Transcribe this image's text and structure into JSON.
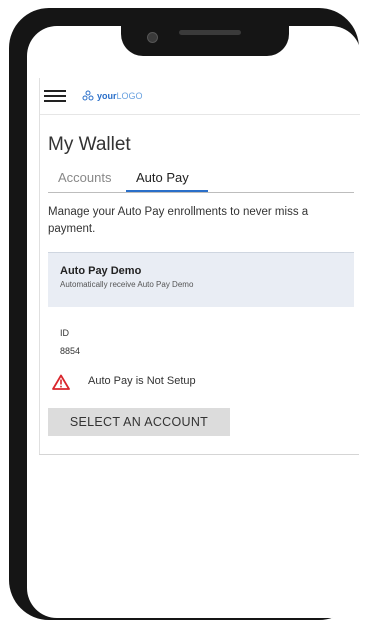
{
  "header": {
    "logo_prefix": "your",
    "logo_suffix": "LOGO"
  },
  "page": {
    "title": "My Wallet",
    "tabs": [
      {
        "label": "Accounts",
        "active": false
      },
      {
        "label": "Auto Pay",
        "active": true
      }
    ],
    "description": "Manage your Auto Pay enrollments to never miss a payment."
  },
  "card": {
    "title": "Auto Pay Demo",
    "subtitle": "Automatically receive Auto Pay Demo"
  },
  "details": {
    "id_label": "ID",
    "id_value": "8854",
    "status_text": "Auto Pay is Not Setup",
    "status_icon": "warning-triangle-icon"
  },
  "actions": {
    "select_account_label": "SELECT AN ACCOUNT"
  },
  "colors": {
    "accent": "#2a6fc9",
    "warning": "#d9262c",
    "card_bg": "#e9edf4",
    "button_bg": "#dcdcdc"
  }
}
